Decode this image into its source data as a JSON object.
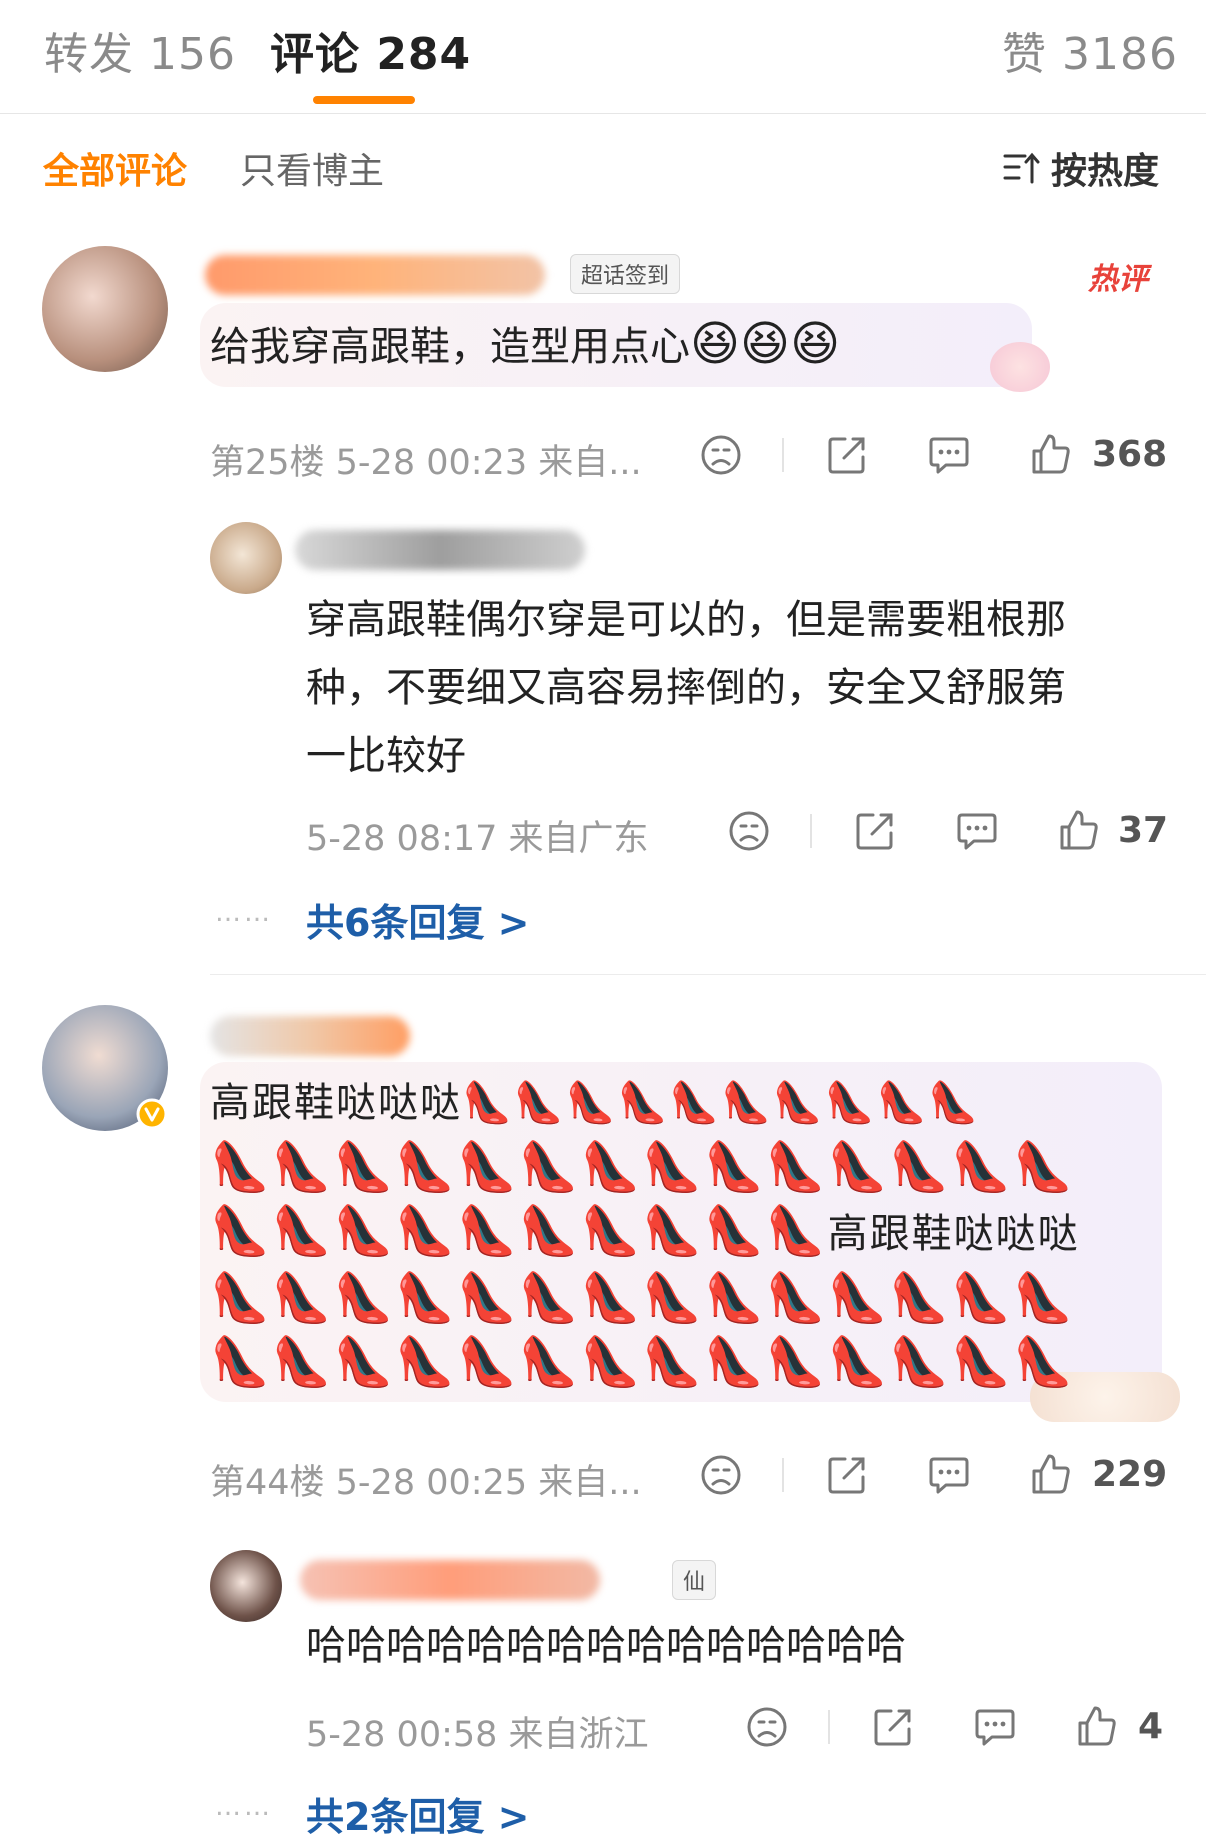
{
  "tabs": {
    "repost": "转发 156",
    "comments": "评论 284",
    "likes": "赞 3186"
  },
  "filters": {
    "all": "全部评论",
    "author_only": "只看博主",
    "sort": "按热度"
  },
  "colors": {
    "accent": "#ff8200",
    "link": "#1e5ea8",
    "hot": "#e8423a"
  },
  "comment1": {
    "badge": "超话签到",
    "hot_label": "热评",
    "text": "给我穿高跟鞋，造型用点心",
    "emojis": "😆😆😆",
    "meta": "第25楼 5-28 00:23 来自...",
    "likes": "368",
    "reply": {
      "text_line1": "穿高跟鞋偶尔穿是可以的，但是需要粗根那",
      "text_line2": "种，不要细又高容易摔倒的，安全又舒服第",
      "text_line3": "一比较好",
      "meta": "5-28 08:17 来自广东",
      "likes": "37"
    },
    "more_replies": "共6条回复 >"
  },
  "comment2": {
    "text_prefix": "高跟鞋哒哒哒",
    "text_mid": "高跟鞋哒哒哒",
    "shoe": "👠",
    "meta": "第44楼 5-28 00:25 来自...",
    "likes": "229",
    "reply": {
      "badge_char": "仙",
      "text": "哈哈哈哈哈哈哈哈哈哈哈哈哈哈哈",
      "meta": "5-28 00:58 来自浙江",
      "likes": "4"
    },
    "more_replies": "共2条回复 >"
  },
  "dots": "……",
  "icons": [
    "sad-face-icon",
    "share-icon",
    "comment-icon",
    "thumbs-up-icon",
    "sort-icon",
    "verified-v-icon"
  ]
}
